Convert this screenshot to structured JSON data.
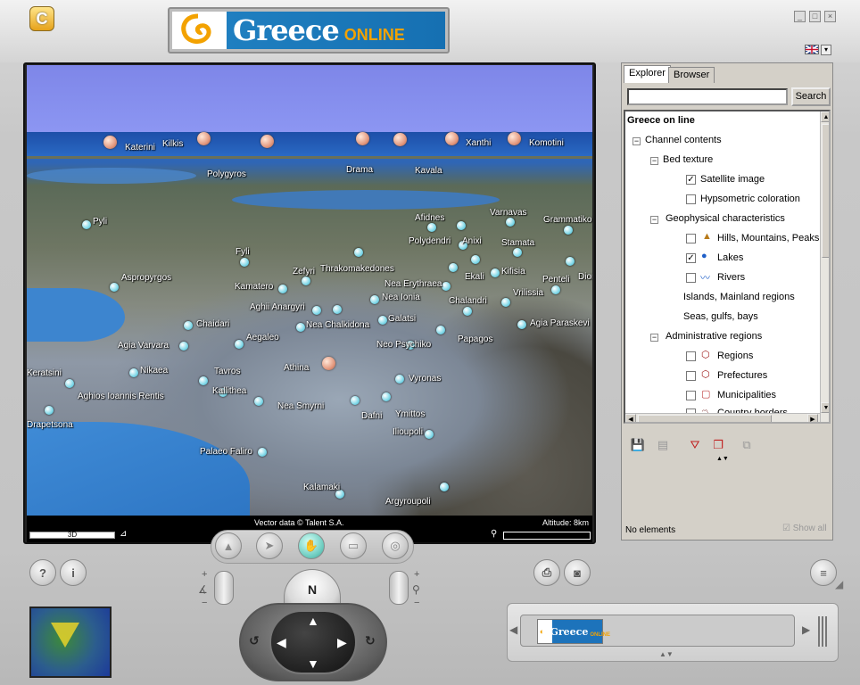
{
  "app": {
    "icon_label": "C",
    "window_buttons": [
      "_",
      "□",
      "×"
    ]
  },
  "logo": {
    "main": "Greece",
    "sub": "ONLINE"
  },
  "viewport": {
    "vector_credit": "Vector data © Talent S.A.",
    "altitude": "Altitude: 8km",
    "mode_label": "3D",
    "places": [
      {
        "name": "Katerini"
      },
      {
        "name": "Kilkis"
      },
      {
        "name": "Polygyros"
      },
      {
        "name": "Drama"
      },
      {
        "name": "Kavala"
      },
      {
        "name": "Xanthi"
      },
      {
        "name": "Komotini"
      },
      {
        "name": "Pyli"
      },
      {
        "name": "Afidnes"
      },
      {
        "name": "Varnavas"
      },
      {
        "name": "Grammatiko"
      },
      {
        "name": "Polydendri"
      },
      {
        "name": "Anixi"
      },
      {
        "name": "Stamata"
      },
      {
        "name": "Fyli"
      },
      {
        "name": "Thrakomakedones"
      },
      {
        "name": "Kifisia"
      },
      {
        "name": "Ekali"
      },
      {
        "name": "Penteli"
      },
      {
        "name": "Dion"
      },
      {
        "name": "Aspropyrgos"
      },
      {
        "name": "Kamatero"
      },
      {
        "name": "Zefyri"
      },
      {
        "name": "Nea Erythraea"
      },
      {
        "name": "Vrilissia"
      },
      {
        "name": "Nea Ionia"
      },
      {
        "name": "Chalandri"
      },
      {
        "name": "Aghii Anargyri"
      },
      {
        "name": "Galatsi"
      },
      {
        "name": "Chaidari"
      },
      {
        "name": "Nea Chalkidona"
      },
      {
        "name": "Agia Paraskevi"
      },
      {
        "name": "Aegaleo"
      },
      {
        "name": "Papagos"
      },
      {
        "name": "Agia Varvara"
      },
      {
        "name": "Neo Psychiko"
      },
      {
        "name": "Nikaea"
      },
      {
        "name": "Athina"
      },
      {
        "name": "Keratsini"
      },
      {
        "name": "Tavros"
      },
      {
        "name": "Vyronas"
      },
      {
        "name": "Kallithea"
      },
      {
        "name": "Aghios Ioannis Rentis"
      },
      {
        "name": "Nea Smyrni"
      },
      {
        "name": "Dafni"
      },
      {
        "name": "Ymittos"
      },
      {
        "name": "Drapetsona"
      },
      {
        "name": "Ilioupoli"
      },
      {
        "name": "Palaeo Faliro"
      },
      {
        "name": "Kalamaki"
      },
      {
        "name": "Argyroupoli"
      }
    ]
  },
  "panel": {
    "tabs": [
      "Explorer",
      "Browser"
    ],
    "search_value": "",
    "search_button": "Search",
    "tree": {
      "root": "Greece on line",
      "channel_contents": "Channel contents",
      "bed_texture": "Bed texture",
      "satellite": "Satellite image",
      "hypsometric": "Hypsometric coloration",
      "geophysical": "Geophysical characteristics",
      "hills": "Hills, Mountains, Peaks",
      "lakes": "Lakes",
      "rivers": "Rivers",
      "islands": "Islands, Mainland regions",
      "seas": "Seas, gulfs, bays",
      "administrative": "Administrative regions",
      "regions": "Regions",
      "prefectures": "Prefectures",
      "municipalities": "Municipalities",
      "borders": "Country borders"
    },
    "no_elements": "No elements",
    "show_all": "Show all"
  },
  "colors": {
    "accent": "#1f7fc0",
    "logo_orange": "#f3a200",
    "active_tool": "#6ecdc0"
  }
}
